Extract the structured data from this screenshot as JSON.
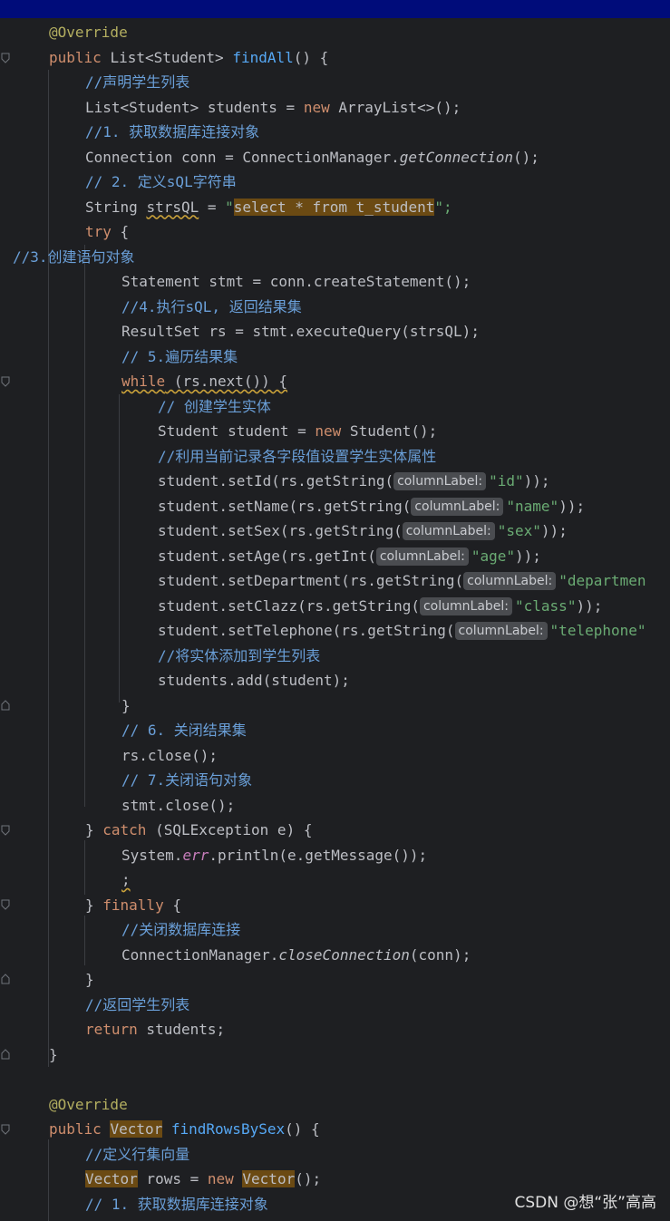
{
  "code": {
    "l01": "@Override",
    "l02_public": "public",
    "l02_type": "List<Student>",
    "l02_method": "findAll",
    "l02_rest": "() {",
    "l03": "//声明学生列表",
    "l04_a": "List<Student> students = ",
    "l04_new": "new",
    "l04_b": " ArrayList<>();",
    "l05": "//1. 获取数据库连接对象",
    "l06_a": "Connection conn = ConnectionManager.",
    "l06_m": "getConnection",
    "l06_b": "();",
    "l07": "// 2. 定义sQL字符串",
    "l08_a": "String ",
    "l08_var": "strsQL",
    "l08_b": " = ",
    "l08_q1": "\"",
    "l08_str": "select * from t_student",
    "l08_q2": "\";",
    "l09_try": "try",
    "l09_b": " {",
    "l10": "//3.创建语句对象",
    "l11": "Statement stmt = conn.createStatement();",
    "l12": "//4.执行sQL, 返回结果集",
    "l13": "ResultSet rs = stmt.executeQuery(strsQL);",
    "l14": "// 5.遍历结果集",
    "l15_while": "while",
    "l15_b": " (rs.next()) {",
    "l16": "// 创建学生实体",
    "l17_a": "Student student = ",
    "l17_new": "new",
    "l17_b": " Student();",
    "l18": "//利用当前记录各字段值设置学生实体属性",
    "hint_label": "columnLabel:",
    "l19_a": "student.setId(rs.getString(",
    "l19_s": "\"id\"",
    "l19_b": "));",
    "l20_a": "student.setName(rs.getString(",
    "l20_s": "\"name\"",
    "l20_b": "));",
    "l21_a": "student.setSex(rs.getString(",
    "l21_s": "\"sex\"",
    "l21_b": "));",
    "l22_a": "student.setAge(rs.getInt(",
    "l22_s": "\"age\"",
    "l22_b": "));",
    "l23_a": "student.setDepartment(rs.getString(",
    "l23_s": "\"departmen",
    "l24_a": "student.setClazz(rs.getString(",
    "l24_s": "\"class\"",
    "l24_b": "));",
    "l25_a": "student.setTelephone(rs.getString(",
    "l25_s": "\"telephone\"",
    "l26": "//将实体添加到学生列表",
    "l27": "students.add(student);",
    "l28": "}",
    "l29": "// 6. 关闭结果集",
    "l30": "rs.close();",
    "l31": "// 7.关闭语句对象",
    "l32": "stmt.close();",
    "l33_a": "} ",
    "l33_catch": "catch",
    "l33_b": " (SQLException e) {",
    "l34_a": "System.",
    "l34_err": "err",
    "l34_b": ".println(e.getMessage());",
    "l35": ";",
    "l36_a": "} ",
    "l36_finally": "finally",
    "l36_b": " {",
    "l37": "//关闭数据库连接",
    "l38_a": "ConnectionManager.",
    "l38_m": "closeConnection",
    "l38_b": "(conn);",
    "l39": "}",
    "l40": "//返回学生列表",
    "l41_return": "return",
    "l41_b": " students;",
    "l42": "}",
    "l43": "@Override",
    "l44_public": "public",
    "l44_type": "Vector",
    "l44_method": "findRowsBySex",
    "l44_rest": "() {",
    "l45": "//定义行集向量",
    "l46_type": "Vector",
    "l46_a": " rows = ",
    "l46_new": "new",
    "l46_type2": "Vector",
    "l46_b": "();",
    "l47": "// 1. 获取数据库连接对象"
  },
  "watermark": "CSDN @想“张”高高",
  "colors": {
    "background": "#1e1f22",
    "top_bar": "#000c7a",
    "keyword": "#cf8e6d",
    "annotation": "#b3ae60",
    "string": "#6aab73",
    "method": "#56a8f5",
    "highlight": "#6b4a13"
  }
}
